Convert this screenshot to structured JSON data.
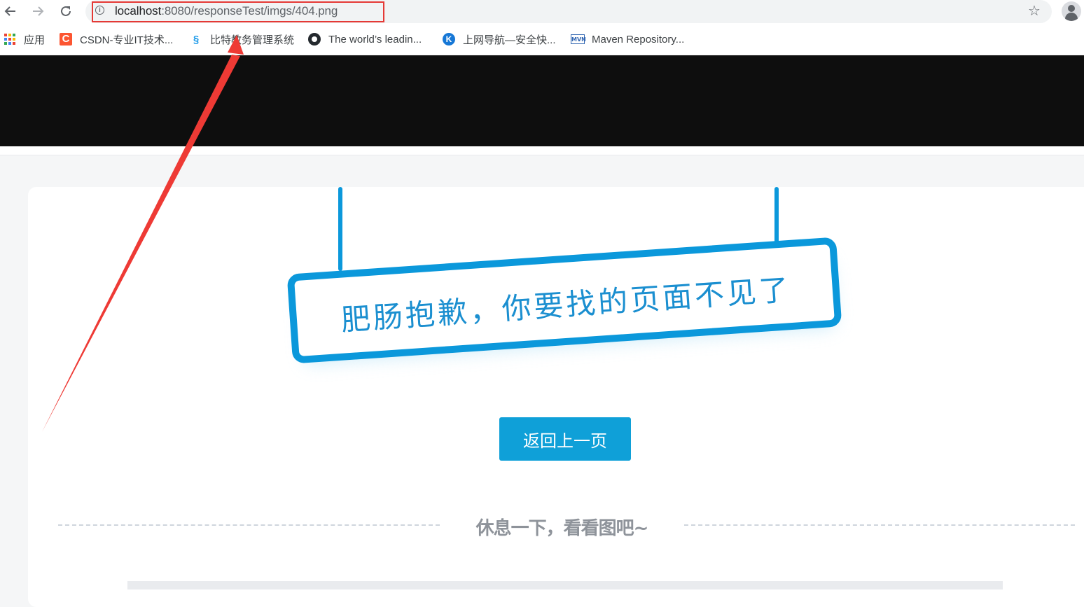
{
  "browser": {
    "url_host": "localhost",
    "url_path": ":8080/responseTest/imgs/404.png",
    "back_icon": "back-arrow-icon",
    "forward_icon": "forward-arrow-icon",
    "reload_icon": "reload-icon",
    "bookmark_icon": "star-icon",
    "profile_icon": "profile-icon",
    "info_symbol": "i"
  },
  "bookmarks": [
    {
      "label": "应用",
      "icon": "apps-grid-icon"
    },
    {
      "label": "CSDN-专业IT技术...",
      "icon": "csdn-icon",
      "icon_text": "C"
    },
    {
      "label": "比特教务管理系统",
      "icon": "bitejiaowu-icon",
      "icon_text": "§"
    },
    {
      "label": "The world’s leadin...",
      "icon": "github-icon"
    },
    {
      "label": "上网导航—安全快...",
      "icon": "k-navigation-icon",
      "icon_text": "K"
    },
    {
      "label": "Maven Repository...",
      "icon": "mvn-icon",
      "icon_text": "MVN"
    }
  ],
  "page": {
    "sign_text": "肥肠抱歉，你要找的页面不见了",
    "back_button": "返回上一页",
    "rest_text": "休息一下，看看图吧~"
  },
  "colors": {
    "header": "#0e0e0e",
    "accent": "#0fa0d8",
    "annotation": "#e53935"
  }
}
